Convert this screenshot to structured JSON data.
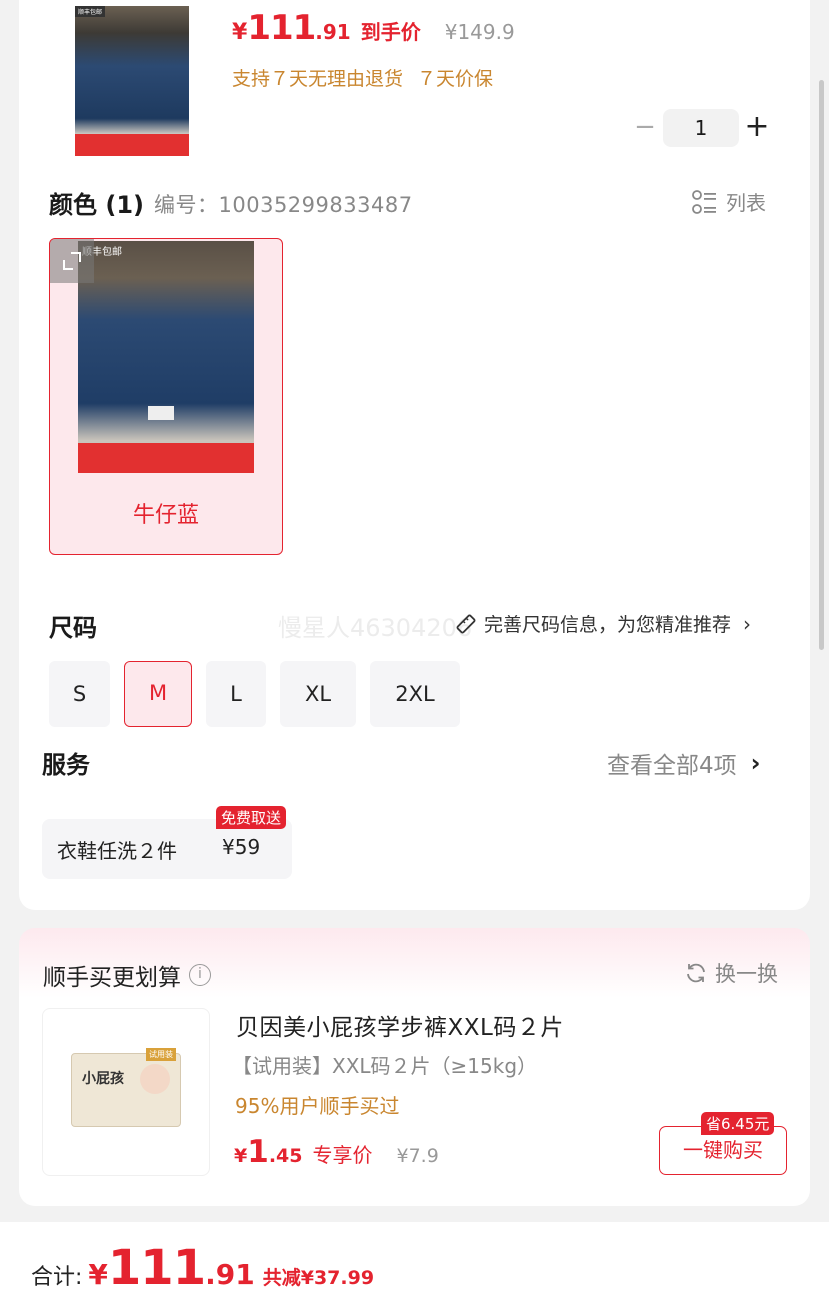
{
  "product": {
    "price_yen": "¥",
    "price_int": "111",
    "price_dec": ".91",
    "price_label": "到手价",
    "original_price": "¥149.9",
    "policies": [
      "支持７天无理由退货",
      "７天价保"
    ],
    "quantity": "1",
    "thumb_tag": "顺丰包邮"
  },
  "color": {
    "title": "颜色 (1)",
    "sku_label": "编号：10035299833487",
    "list_label": "列表",
    "options": [
      {
        "name": "牛仔蓝",
        "tag": "顺丰包邮",
        "selected": true
      }
    ]
  },
  "size": {
    "title": "尺码",
    "watermark": "慢星人46304206",
    "hint": "完善尺码信息，为您精准推荐",
    "options": [
      {
        "label": "S",
        "selected": false
      },
      {
        "label": "M",
        "selected": true
      },
      {
        "label": "L",
        "selected": false
      },
      {
        "label": "XL",
        "selected": false
      },
      {
        "label": "2XL",
        "selected": false
      }
    ]
  },
  "service": {
    "title": "服务",
    "view_all": "查看全部4项",
    "items": [
      {
        "name": "衣鞋任洗２件",
        "price": "¥59",
        "badge": "免费取送"
      }
    ]
  },
  "addon": {
    "title": "顺手买更划算",
    "info_glyph": "i",
    "swap_label": "换一换",
    "product_name": "贝因美小屁孩学步裤XXL码２片",
    "spec": "【试用装】XXL码２片（≥15kg）",
    "users_text": "95%用户顺手买过",
    "price_yen": "¥",
    "price_int": "1",
    "price_dec": ".45",
    "price_label": "专享价",
    "original_price": "¥7.9",
    "save_badge": "省6.45元",
    "buy_label": "一键购买",
    "pack_text": "小屁孩",
    "pack_label": "试用装"
  },
  "footer": {
    "total_label": "合计:",
    "total_yen": "¥",
    "total_int": "111",
    "total_dec": ".91",
    "discount": "共减¥37.99"
  },
  "colors": {
    "accent_red": "#e4232f",
    "gold": "#c9862f",
    "selected_bg": "#fde8ec"
  }
}
